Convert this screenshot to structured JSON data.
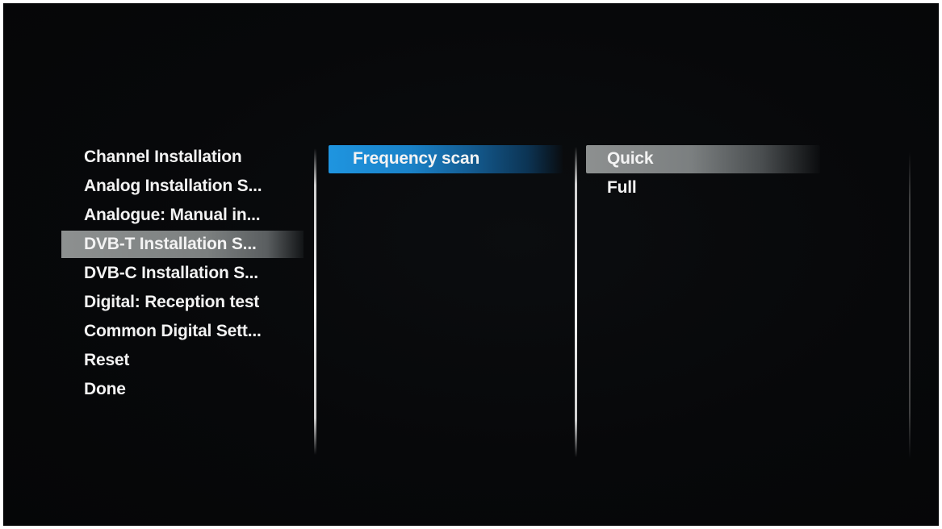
{
  "left_menu": {
    "items": [
      {
        "label": "Channel Installation"
      },
      {
        "label": "Analog Installation S..."
      },
      {
        "label": "Analogue: Manual in..."
      },
      {
        "label": "DVB-T Installation S...",
        "selected": true
      },
      {
        "label": "DVB-C Installation S..."
      },
      {
        "label": "Digital: Reception test"
      },
      {
        "label": "Common Digital Sett..."
      },
      {
        "label": "Reset"
      },
      {
        "label": "Done"
      }
    ]
  },
  "middle_menu": {
    "items": [
      {
        "label": "Frequency scan",
        "selected": true
      }
    ]
  },
  "right_menu": {
    "items": [
      {
        "label": "Quick",
        "selected": true
      },
      {
        "label": "Full"
      }
    ]
  },
  "colors": {
    "background": "#07080a",
    "text": "#f3f3f3",
    "focus_highlight": "#1f95e0",
    "selection_highlight": "#8d9090"
  }
}
